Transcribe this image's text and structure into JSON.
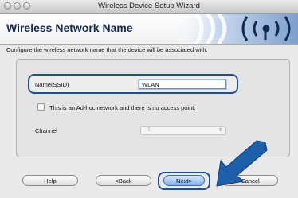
{
  "window": {
    "title": "Wireless Device Setup Wizard"
  },
  "header": {
    "title": "Wireless Network Name"
  },
  "instruction": "Configure the wireless network name that the device will be associated with.",
  "ssid": {
    "label": "Name(SSID)",
    "value": "WLAN"
  },
  "adhoc": {
    "label": "This is an Ad-hoc network and there is no access point.",
    "checked": false
  },
  "channel": {
    "label": "Channel",
    "value": "1"
  },
  "buttons": {
    "help": "Help",
    "back": "<Back",
    "next": "Next>",
    "cancel": "Cancel"
  },
  "colors": {
    "highlight": "#1f4f8c",
    "arrow": "#1d5fa8",
    "header_title": "#10294f"
  },
  "icons": {
    "header_logo": "wireless-signal-icon",
    "pointer": "arrow-pointer-icon"
  }
}
